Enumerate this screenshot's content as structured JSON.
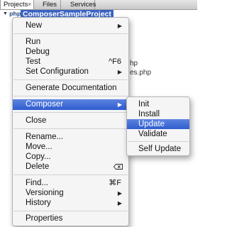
{
  "tabs": [
    {
      "label": "Projects",
      "close": "×"
    },
    {
      "label": "Files"
    },
    {
      "label": "Services"
    }
  ],
  "tree": {
    "toggle": "▼",
    "icon_text": "php",
    "project_name": "ComposerSampleProject",
    "background_fragments": [
      "hp",
      "es.php"
    ]
  },
  "context_menu": {
    "items": [
      {
        "label": "New",
        "submenu": true
      },
      {
        "label": "Run"
      },
      {
        "label": "Debug"
      },
      {
        "label": "Test",
        "shortcut": "^F6"
      },
      {
        "label": "Set Configuration",
        "submenu": true
      },
      {
        "label": "Generate Documentation"
      },
      {
        "label": "Composer",
        "submenu": true,
        "selected": true
      },
      {
        "label": "Close"
      },
      {
        "label": "Rename..."
      },
      {
        "label": "Move..."
      },
      {
        "label": "Copy..."
      },
      {
        "label": "Delete",
        "icon": "delete-key-icon"
      },
      {
        "label": "Find...",
        "shortcut": "⌘F"
      },
      {
        "label": "Versioning",
        "submenu": true
      },
      {
        "label": "History",
        "submenu": true
      },
      {
        "label": "Properties"
      }
    ],
    "submenu_arrow": "▶"
  },
  "composer_submenu": {
    "items": [
      {
        "label": "Init"
      },
      {
        "label": "Install"
      },
      {
        "label": "Update",
        "selected": true
      },
      {
        "label": "Validate"
      },
      {
        "label": "Self Update"
      }
    ]
  },
  "colors": {
    "selection": "#3b63c3",
    "menu_background": "#f5f5f5"
  }
}
